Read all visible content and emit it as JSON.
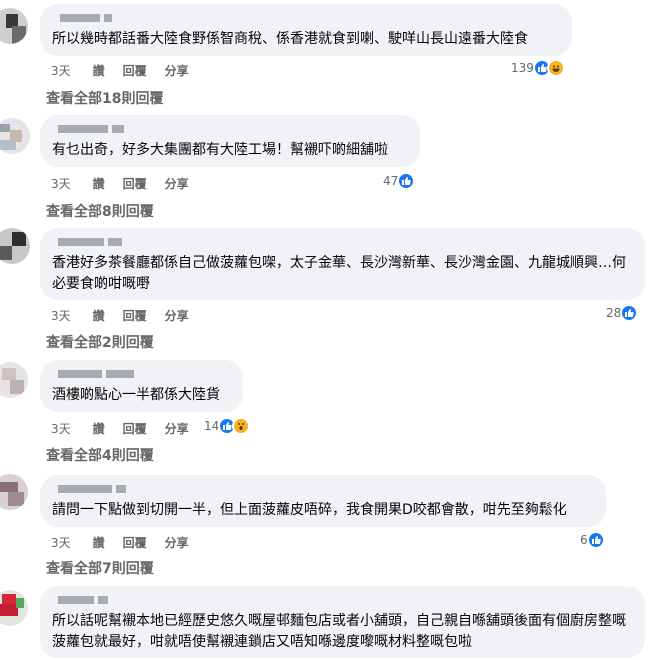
{
  "colors": {
    "bubble": "#f0f2f5",
    "meta": "#65676b",
    "like": "#1877f2",
    "emoji": "#f7b125"
  },
  "comments": [
    {
      "text": "所以幾時都話番大陸食野係智商稅、係香港就食到喇、駛咩山長山遠番大陸食",
      "time": "3天",
      "like_label": "讚",
      "reply_label": "回覆",
      "share_label": "分享",
      "reaction_count": "139",
      "reactions": [
        "like-icon",
        "haha-icon"
      ],
      "view_replies": "查看全部18則回覆"
    },
    {
      "text": "有乜出奇，好多大集團都有大陸工場！幫襯吓啲細舖啦",
      "time": "3天",
      "like_label": "讚",
      "reply_label": "回覆",
      "share_label": "分享",
      "reaction_count": "47",
      "reactions": [
        "like-icon"
      ],
      "view_replies": "查看全部8則回覆"
    },
    {
      "text": "香港好多茶餐廳都係自己做菠蘿包㗎，太子金華、長沙灣新華、長沙灣金園、九龍城順興…何必要食啲咁嘅嘢",
      "time": "3天",
      "like_label": "讚",
      "reply_label": "回覆",
      "share_label": "分享",
      "reaction_count": "28",
      "reactions": [
        "like-icon"
      ],
      "view_replies": "查看全部2則回覆"
    },
    {
      "text": "酒樓啲點心一半都係大陸貨",
      "time": "3天",
      "like_label": "讚",
      "reply_label": "回覆",
      "share_label": "分享",
      "reaction_count": "14",
      "reactions": [
        "like-icon",
        "wow-icon"
      ],
      "view_replies": "查看全部4則回覆"
    },
    {
      "text": "請問一下點做到切開一半，但上面菠蘿皮唔碎，我食開果D咬都會散，咁先至夠鬆化",
      "time": "3天",
      "like_label": "讚",
      "reply_label": "回覆",
      "share_label": "分享",
      "reaction_count": "6",
      "reactions": [
        "like-icon"
      ],
      "view_replies": "查看全部7則回覆"
    },
    {
      "text": "所以話呢幫襯本地已經歷史悠久嘅屋邨麵包店或者小舖頭，自己親自喺舖頭後面有個廚房整嘅菠蘿包就最好，咁就唔使幫襯連鎖店又唔知喺邊度嚟嘅材料整嘅包啦"
    }
  ]
}
